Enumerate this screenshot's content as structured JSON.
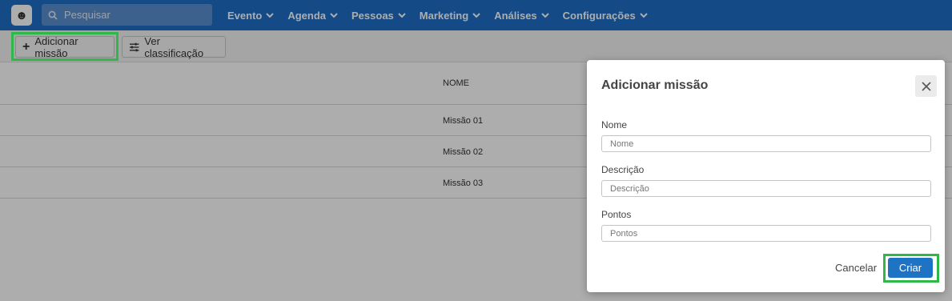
{
  "topbar": {
    "logo_icon": "user-avatar-icon",
    "search": {
      "placeholder": "Pesquisar",
      "icon": "search-icon"
    },
    "nav": [
      {
        "label": "Evento"
      },
      {
        "label": "Agenda"
      },
      {
        "label": "Pessoas"
      },
      {
        "label": "Marketing"
      },
      {
        "label": "Análises"
      },
      {
        "label": "Configurações"
      }
    ]
  },
  "toolbar": {
    "add_label": "Adicionar missão",
    "add_icon": "plus-icon",
    "ranking_label": "Ver classificação",
    "ranking_icon": "sliders-icon"
  },
  "table": {
    "columns": [
      "NOME"
    ],
    "rows": [
      "Missão 01",
      "Missão 02",
      "Missão 03"
    ]
  },
  "modal": {
    "title": "Adicionar missão",
    "fields": [
      {
        "label": "Nome",
        "placeholder": "Nome"
      },
      {
        "label": "Descrição",
        "placeholder": "Descrição"
      },
      {
        "label": "Pontos",
        "placeholder": "Pontos"
      }
    ],
    "cancel_label": "Cancelar",
    "submit_label": "Criar"
  },
  "colors": {
    "nav_bg": "#1e6ec4",
    "primary_button": "#1f73c5",
    "highlight": "#2eb84a"
  }
}
